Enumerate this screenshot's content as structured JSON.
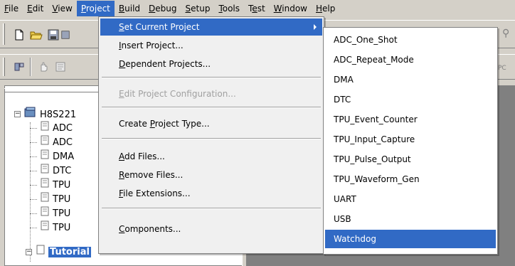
{
  "menubar": {
    "items": [
      {
        "label": "File",
        "accel": "F",
        "rest": "ile"
      },
      {
        "label": "Edit",
        "accel": "E",
        "rest": "dit"
      },
      {
        "label": "View",
        "accel": "V",
        "rest": "iew"
      },
      {
        "label": "Project",
        "accel": "P",
        "rest": "roject",
        "active": true
      },
      {
        "label": "Build",
        "accel": "B",
        "rest": "uild"
      },
      {
        "label": "Debug",
        "accel": "D",
        "rest": "ebug"
      },
      {
        "label": "Setup",
        "accel": "S",
        "rest": "etup"
      },
      {
        "label": "Tools",
        "accel": "T",
        "rest": "ools"
      },
      {
        "label": "Test",
        "accel": "e",
        "pre": "T",
        "rest": "st"
      },
      {
        "label": "Window",
        "accel": "W",
        "rest": "indow"
      },
      {
        "label": "Help",
        "accel": "H",
        "rest": "elp"
      }
    ]
  },
  "toolbar": {
    "icons": [
      "new-file-icon",
      "open-folder-icon",
      "save-icon",
      "save-all-icon"
    ],
    "icons2": [
      "workspace-icon",
      "hand-icon",
      "properties-icon"
    ],
    "peek_right": "PC"
  },
  "project_menu": {
    "items": [
      {
        "pre": "",
        "acc": "S",
        "rest": "et Current Project",
        "has_submenu": true,
        "highlighted": true
      },
      {
        "pre": "",
        "acc": "I",
        "rest": "nsert Project..."
      },
      {
        "pre": "",
        "acc": "D",
        "rest": "ependent Projects..."
      },
      {
        "pre": "",
        "acc": "E",
        "rest": "dit Project Configuration...",
        "disabled": true
      },
      {
        "pre": "Create ",
        "acc": "P",
        "rest": "roject Type..."
      },
      {
        "pre": "",
        "acc": "A",
        "rest": "dd Files..."
      },
      {
        "pre": "",
        "acc": "R",
        "rest": "emove Files..."
      },
      {
        "pre": "",
        "acc": "F",
        "rest": "ile Extensions..."
      },
      {
        "pre": "",
        "acc": "C",
        "rest": "omponents..."
      }
    ]
  },
  "set_current_project_submenu": {
    "items": [
      "ADC_One_Shot",
      "ADC_Repeat_Mode",
      "DMA",
      "DTC",
      "TPU_Event_Counter",
      "TPU_Input_Capture",
      "TPU_Pulse_Output",
      "TPU_Waveform_Gen",
      "UART",
      "USB",
      "Watchdog"
    ],
    "highlighted": "Watchdog"
  },
  "workspace": {
    "root": "H8S221",
    "children": [
      "ADC",
      "ADC",
      "DMA",
      "DTC",
      "TPU",
      "TPU",
      "TPU",
      "TPU"
    ],
    "selected": "Tutorial"
  },
  "colors": {
    "highlight": "#316ac5",
    "face": "#d4d0c8",
    "mdi_background": "#808080"
  }
}
